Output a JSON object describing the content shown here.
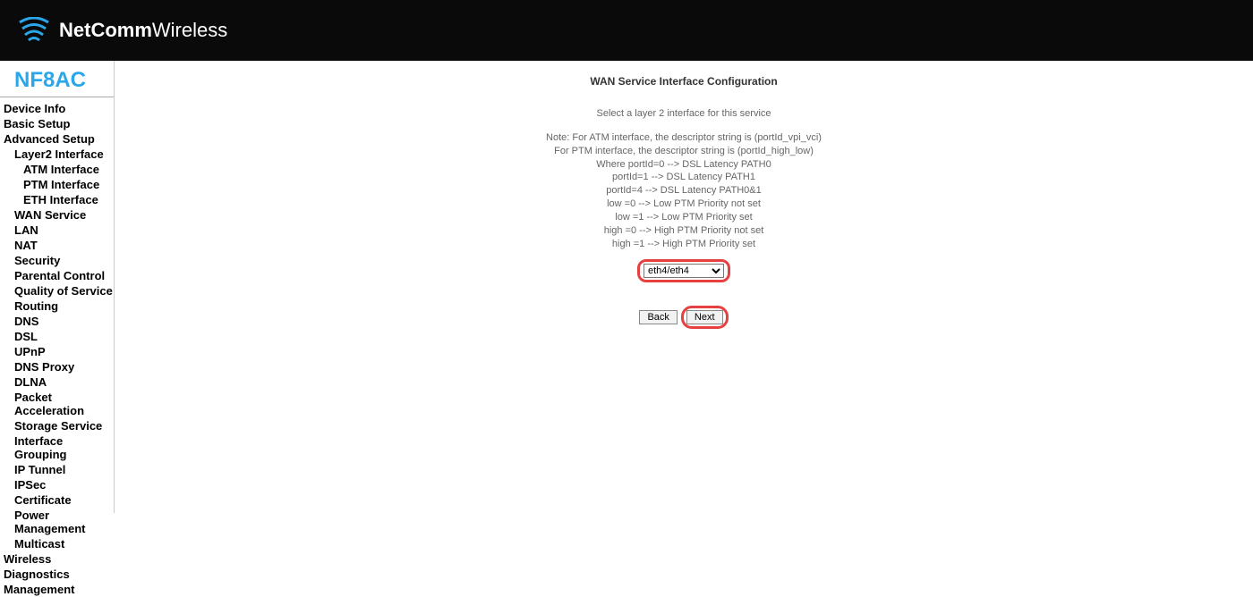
{
  "brand": {
    "name_bold": "NetComm",
    "name_light": "Wireless"
  },
  "model": "NF8AC",
  "nav": {
    "device_info": "Device Info",
    "basic_setup": "Basic Setup",
    "advanced_setup": "Advanced Setup",
    "layer2": "Layer2 Interface",
    "atm": "ATM Interface",
    "ptm": "PTM Interface",
    "eth": "ETH Interface",
    "wan": "WAN Service",
    "lan": "LAN",
    "nat": "NAT",
    "security": "Security",
    "parental": "Parental Control",
    "qos": "Quality of Service",
    "routing": "Routing",
    "dns": "DNS",
    "dsl": "DSL",
    "upnp": "UPnP",
    "dnsproxy": "DNS Proxy",
    "dlna": "DLNA",
    "packet": "Packet Acceleration",
    "storage": "Storage Service",
    "ifgroup": "Interface Grouping",
    "iptunnel": "IP Tunnel",
    "ipsec": "IPSec",
    "cert": "Certificate",
    "power": "Power Management",
    "multicast": "Multicast",
    "wireless": "Wireless",
    "diagnostics": "Diagnostics",
    "management": "Management"
  },
  "page": {
    "title": "WAN Service Interface Configuration",
    "select_label": "Select a layer 2 interface for this service",
    "note1": "Note: For ATM interface, the descriptor string is (portId_vpi_vci)",
    "note2": "For PTM interface, the descriptor string is (portId_high_low)",
    "note3": "Where portId=0 --> DSL Latency PATH0",
    "note4": "portId=1 --> DSL Latency PATH1",
    "note5": "portId=4 --> DSL Latency PATH0&1",
    "note6": "low =0 --> Low PTM Priority not set",
    "note7": "low =1 --> Low PTM Priority set",
    "note8": "high =0 --> High PTM Priority not set",
    "note9": "high =1 --> High PTM Priority set",
    "select_value": "eth4/eth4",
    "btn_back": "Back",
    "btn_next": "Next"
  }
}
